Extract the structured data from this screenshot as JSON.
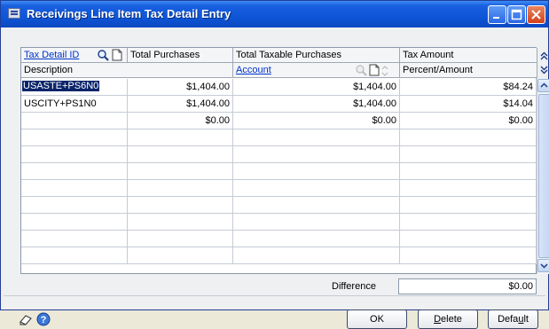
{
  "window": {
    "title": "Receivings Line Item Tax Detail Entry"
  },
  "headers": {
    "tax_detail_id": "Tax Detail ID",
    "total_purchases": "Total Purchases",
    "total_taxable_purchases": "Total Taxable Purchases",
    "tax_amount": "Tax Amount",
    "description": "Description",
    "account": "Account",
    "percent_amount": "Percent/Amount"
  },
  "rows": [
    {
      "id": "USASTE+PS6N0",
      "total": "$1,404.00",
      "taxable": "$1,404.00",
      "tax": "$84.24"
    },
    {
      "id": "USCITY+PS1N0",
      "total": "$1,404.00",
      "taxable": "$1,404.00",
      "tax": "$14.04"
    },
    {
      "id": "",
      "total": "$0.00",
      "taxable": "$0.00",
      "tax": "$0.00"
    }
  ],
  "footer": {
    "difference_label": "Difference",
    "difference_value": "$0.00"
  },
  "buttons": {
    "ok": "OK",
    "delete_prefix": "",
    "delete_hot": "D",
    "delete_rest": "elete",
    "default_prefix": "Defa",
    "default_hot": "u",
    "default_rest": "lt"
  },
  "icons": {
    "lookup": "magnifier-icon",
    "new": "new-document-icon",
    "note": "note-icon",
    "help": "help-icon"
  }
}
